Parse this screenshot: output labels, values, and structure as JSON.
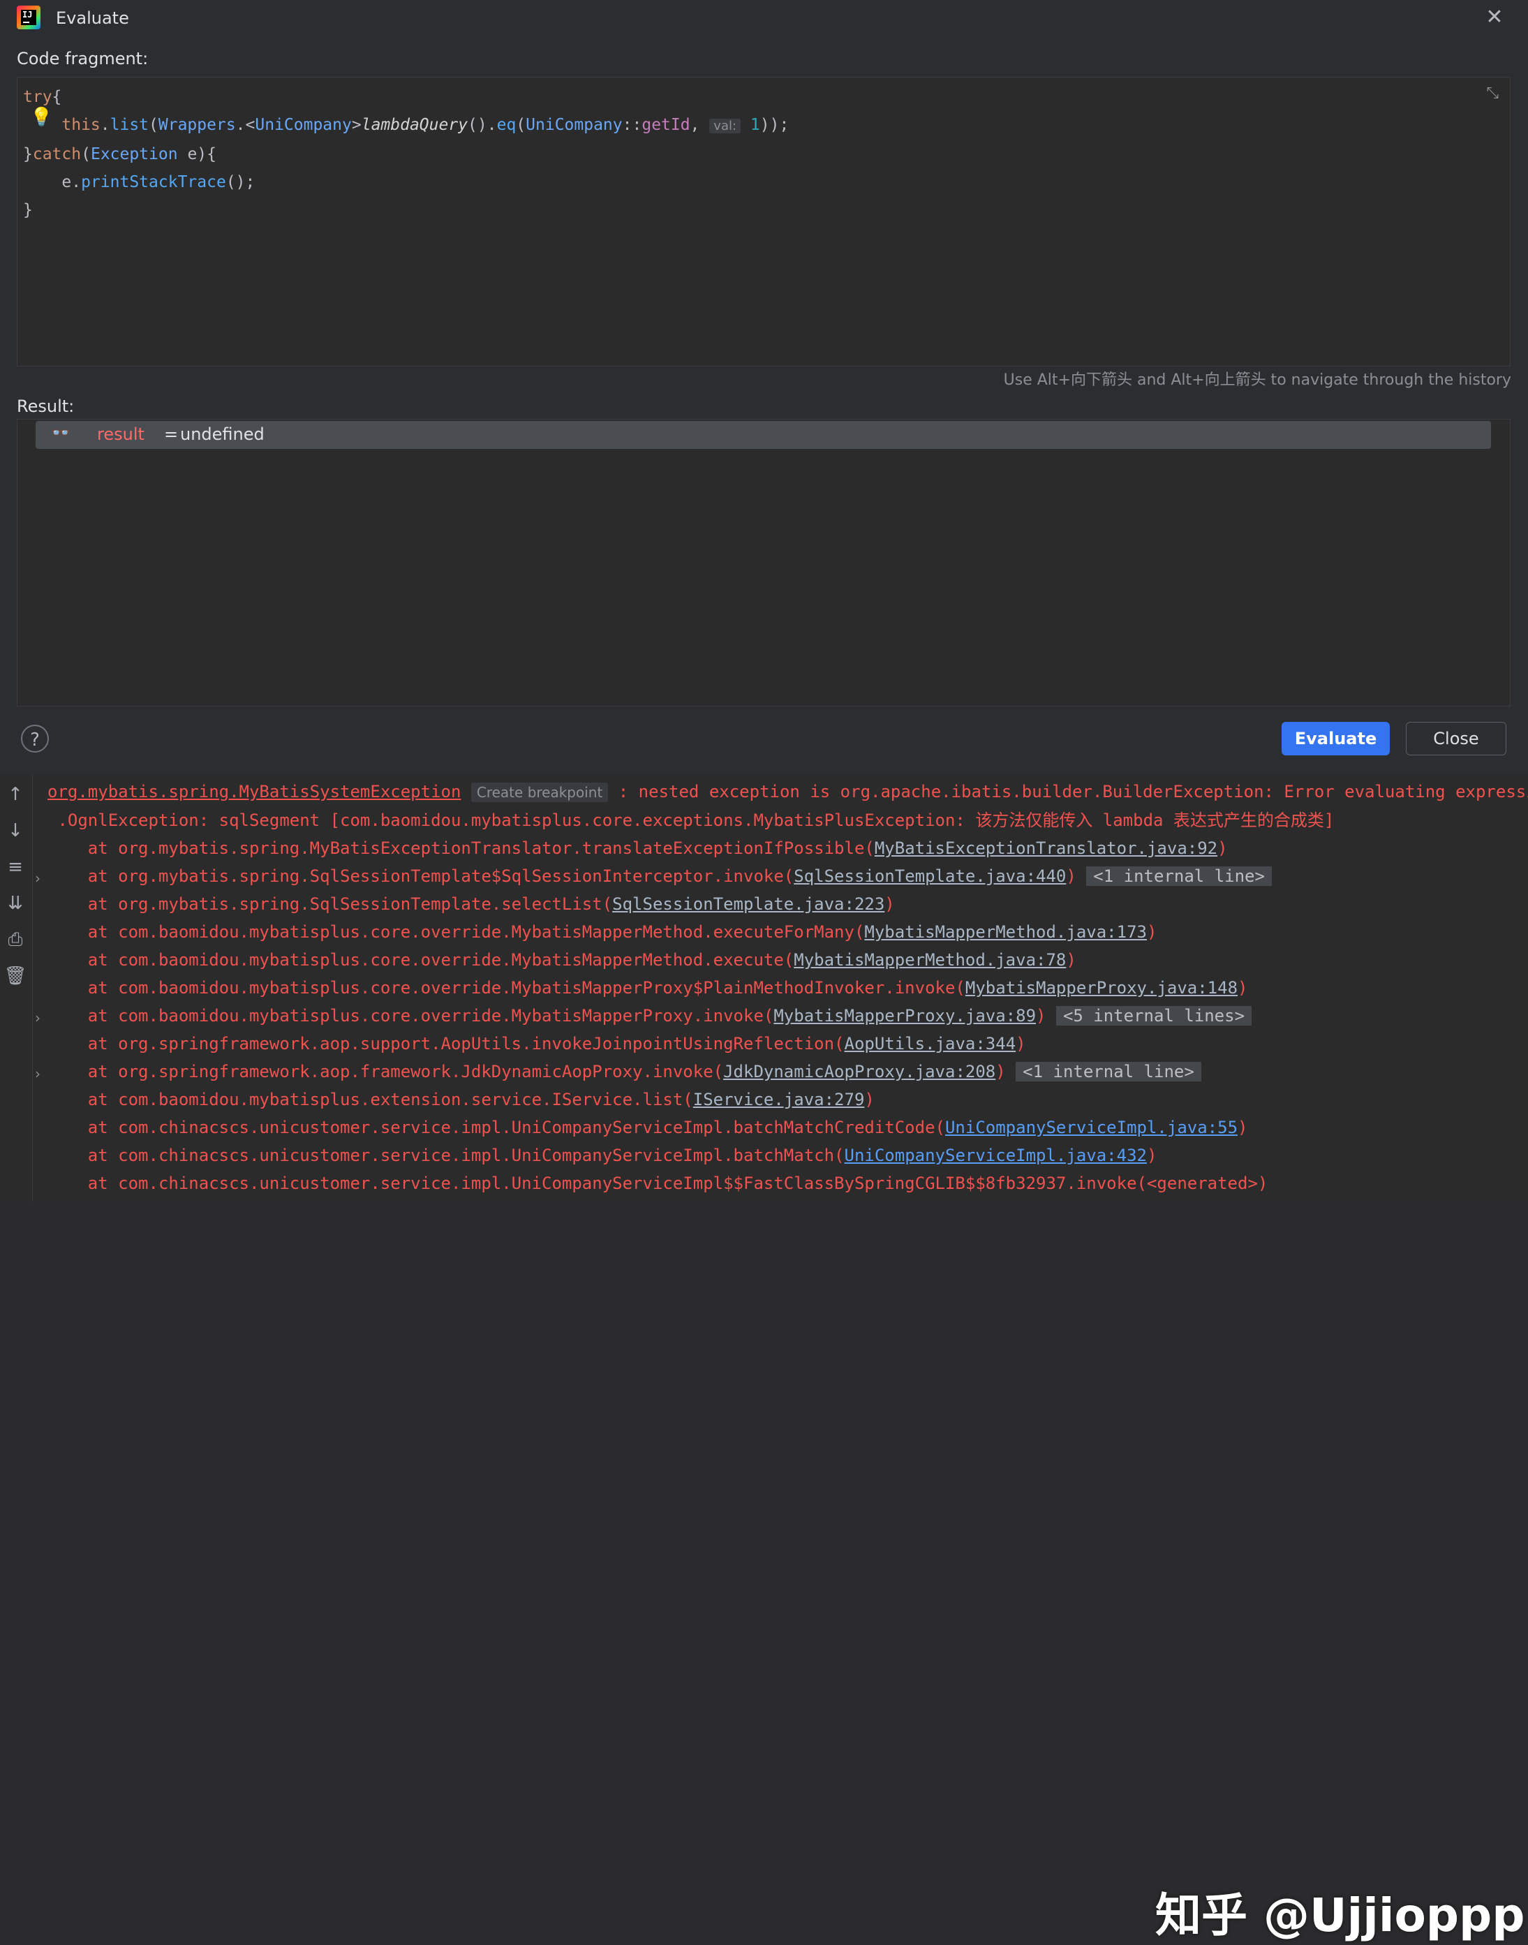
{
  "window": {
    "title": "Evaluate"
  },
  "labels": {
    "code_fragment": "Code fragment:",
    "result": "Result:",
    "history_hint": "Use Alt+向下箭头 and Alt+向上箭头 to navigate through the history"
  },
  "code": {
    "lines": [
      "try{",
      "    this.list(Wrappers.<UniCompany>lambdaQuery().eq(UniCompany::getId,  val: 1));",
      "}catch(Exception e){",
      "    e.printStackTrace();",
      "}"
    ],
    "param_hint": "val:"
  },
  "result": {
    "name": "result",
    "eq": "=",
    "value": "undefined"
  },
  "buttons": {
    "help": "?",
    "evaluate": "Evaluate",
    "close": "Close"
  },
  "console": {
    "create_breakpoint": "Create breakpoint",
    "lines": [
      "org.mybatis.spring.MyBatisSystemException",
      ": nested exception is org.apache.ibatis.builder.BuilderException: Error evaluating expression 'e",
      " .OgnlException: sqlSegment [com.baomidou.mybatisplus.core.exceptions.MybatisPlusException: 该方法仅能传入 lambda 表达式产生的合成类]",
      "at org.mybatis.spring.MyBatisExceptionTranslator.translateExceptionIfPossible(",
      "MyBatisExceptionTranslator.java:92",
      "at org.mybatis.spring.SqlSessionTemplate$SqlSessionInterceptor.invoke(",
      "SqlSessionTemplate.java:440",
      "<1 internal line>",
      "at org.mybatis.spring.SqlSessionTemplate.selectList(",
      "SqlSessionTemplate.java:223",
      "at com.baomidou.mybatisplus.core.override.MybatisMapperMethod.executeForMany(",
      "MybatisMapperMethod.java:173",
      "at com.baomidou.mybatisplus.core.override.MybatisMapperMethod.execute(",
      "MybatisMapperMethod.java:78",
      "at com.baomidou.mybatisplus.core.override.MybatisMapperProxy$PlainMethodInvoker.invoke(",
      "MybatisMapperProxy.java:148",
      "at com.baomidou.mybatisplus.core.override.MybatisMapperProxy.invoke(",
      "MybatisMapperProxy.java:89",
      "<5 internal lines>",
      "at org.springframework.aop.support.AopUtils.invokeJoinpointUsingReflection(",
      "AopUtils.java:344",
      "at org.springframework.aop.framework.JdkDynamicAopProxy.invoke(",
      "JdkDynamicAopProxy.java:208",
      "<1 internal line>",
      "at com.baomidou.mybatisplus.extension.service.IService.list(",
      "IService.java:279",
      "at com.chinacscs.unicustomer.service.impl.UniCompanyServiceImpl.batchMatchCreditCode(",
      "UniCompanyServiceImpl.java:55",
      "at com.chinacscs.unicustomer.service.impl.UniCompanyServiceImpl.batchMatch(",
      "UniCompanyServiceImpl.java:432",
      "at com.chinacscs.unicustomer.service.impl.UniCompanyServiceImpl$$FastClassBySpringCGLIB$$8fb32937.invoke(<generated>)"
    ]
  },
  "watermark": "知乎 @Ujjioppp"
}
